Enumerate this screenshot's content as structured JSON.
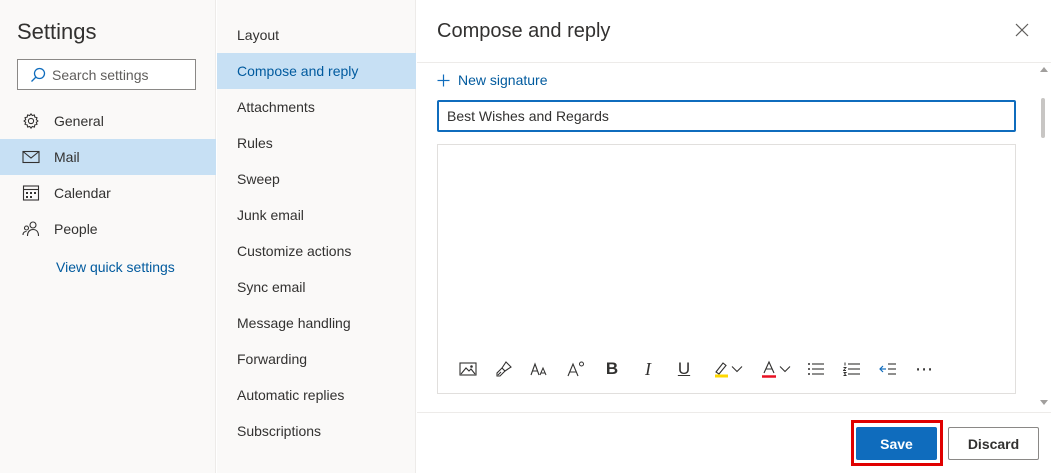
{
  "settings": {
    "title": "Settings",
    "search_placeholder": "Search settings",
    "nav": [
      {
        "label": "General",
        "icon": "gear-icon"
      },
      {
        "label": "Mail",
        "icon": "mail-icon",
        "selected": true
      },
      {
        "label": "Calendar",
        "icon": "calendar-icon"
      },
      {
        "label": "People",
        "icon": "people-icon"
      }
    ],
    "quick_settings_label": "View quick settings"
  },
  "mail_sections": [
    "Layout",
    "Compose and reply",
    "Attachments",
    "Rules",
    "Sweep",
    "Junk email",
    "Customize actions",
    "Sync email",
    "Message handling",
    "Forwarding",
    "Automatic replies",
    "Subscriptions"
  ],
  "selected_section": "Compose and reply",
  "pane": {
    "title": "Compose and reply",
    "new_signature_label": "New signature",
    "signature_name_value": "Best Wishes and Regards",
    "toolbar_icons": [
      "insert-picture-icon",
      "format-painter-icon",
      "font-size-icon",
      "text-effects-icon",
      "bold-icon",
      "italic-icon",
      "underline-icon",
      "highlight-icon",
      "font-color-icon",
      "bullets-icon",
      "numbering-icon",
      "decrease-indent-icon",
      "more-options-icon"
    ],
    "toolbar_glyphs": {
      "bold": "B",
      "italic": "I",
      "underline": "U",
      "more": "⋯"
    },
    "save_label": "Save",
    "discard_label": "Discard"
  },
  "colors": {
    "accent": "#0f6cbd",
    "selected_bg": "#c7e0f4",
    "highlight_yellow": "#ffd800",
    "font_color_red": "#e81123",
    "annotation_red": "#e00000"
  }
}
